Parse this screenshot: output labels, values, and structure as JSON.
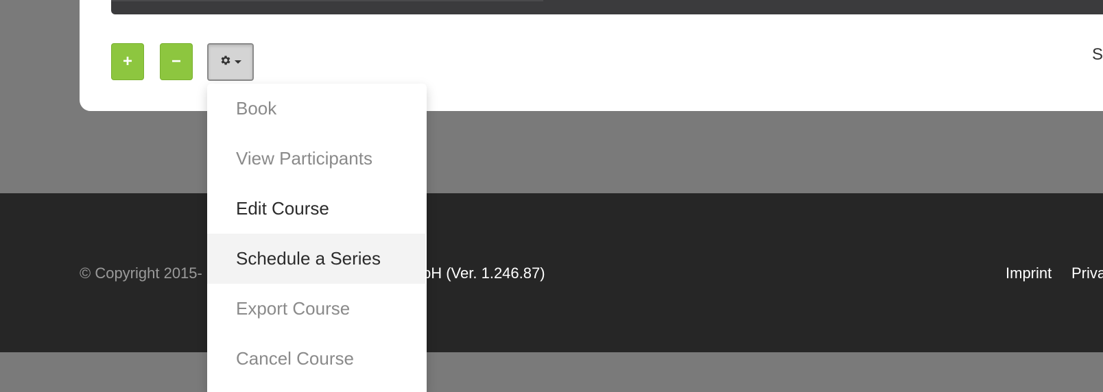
{
  "toolbar": {
    "add_label": "+",
    "remove_label": "−",
    "settings_icon": "gear-icon",
    "caret_icon": "caret-down-icon",
    "cut_off_text": "S"
  },
  "menu": {
    "items": [
      {
        "label": "Book",
        "state": "disabled"
      },
      {
        "label": "View Participants",
        "state": "disabled"
      },
      {
        "label": "Edit Course",
        "state": "enabled"
      },
      {
        "label": "Schedule a Series",
        "state": "hovered"
      },
      {
        "label": "Export Course",
        "state": "disabled"
      },
      {
        "label": "Cancel Course",
        "state": "disabled"
      }
    ]
  },
  "footer": {
    "copyright_start": "© Copyright 2015-",
    "copyright_end": "bH (Ver. 1.246.87)",
    "links": [
      "Imprint",
      "Priva"
    ]
  },
  "colors": {
    "accent_green": "#8dc63f",
    "footer_bg": "#262626",
    "page_bg": "#7a7a7a"
  }
}
